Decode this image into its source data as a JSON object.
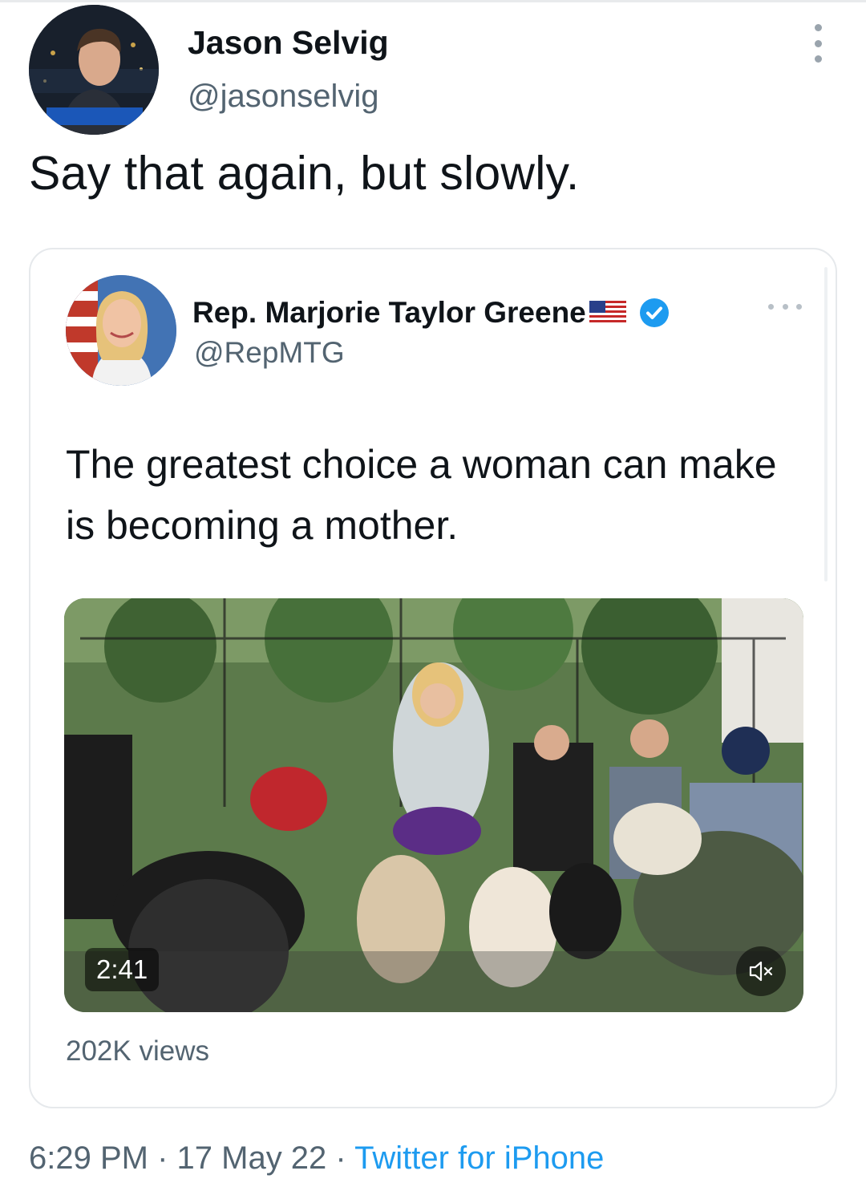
{
  "tweet": {
    "author_name": "Jason Selvig",
    "author_handle": "@jasonselvig",
    "text": "Say that again, but slowly.",
    "avatar_caption": "JASON SELVIG",
    "time": "6:29 PM",
    "separator": " · ",
    "date": "17 May 22",
    "source": "Twitter for iPhone"
  },
  "quoted_tweet": {
    "author_name": "Rep. Marjorie Taylor Greene",
    "author_handle": "@RepMTG",
    "text": "The greatest choice a woman can make is becoming a mother.",
    "video_duration": "2:41",
    "views": "202K views",
    "verified": true
  },
  "icons": {
    "more": "more-options-icon",
    "flag": "us-flag-icon",
    "verified": "verified-badge-icon",
    "mute": "muted-speaker-icon"
  },
  "colors": {
    "link": "#1d9bf0",
    "secondary_text": "#536471",
    "primary_text": "#0f1419",
    "border": "#e6e9ec"
  }
}
